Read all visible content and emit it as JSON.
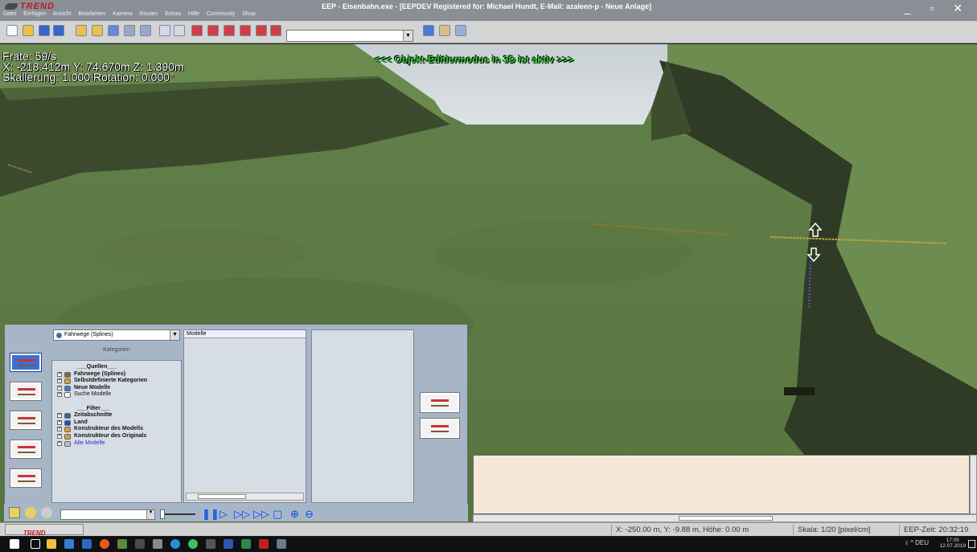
{
  "window": {
    "logo": "TREND",
    "title": "EEP - Eisenbahn.exe - [EEPDEV Registered for: Michael Hundt, E-Mail: azaleen-p - Neue Anlage]",
    "controls": "_ ▫ ✕"
  },
  "menu": [
    "Datei",
    "Einfügen",
    "Ansicht",
    "Bearbeiten",
    "Kamera",
    "Routen",
    "Extras",
    "Hilfe",
    "Community",
    "Shop"
  ],
  "hud": {
    "frate": "Frate: 59/s",
    "coords": "X: -218.412m Y: 74.670m Z: 1.390m",
    "scale": "Skalierung: 1.000 Rotation: 0.000°",
    "mode_banner": "<<<  Objekt-Editiermodus in 3D ist aktiv  >>>"
  },
  "panel": {
    "category_combo": "Fahrwege (Splines)",
    "categories_header": "Kategorien",
    "models_header": "Modelle",
    "tree": [
      {
        "type": "sec",
        "label": "___Quellen___"
      },
      {
        "type": "item",
        "label": "Fahrwege (Splines)",
        "bold": true,
        "icon_color": "#7a6b3a"
      },
      {
        "type": "item",
        "label": "Selbstdefinierte Kategorien",
        "bold": true,
        "icon_color": "#d8a030"
      },
      {
        "type": "item",
        "label": "Neue Modelle",
        "bold": true,
        "icon_color": "#3a7ad0"
      },
      {
        "type": "item",
        "label": "Suche Modelle",
        "bold": false,
        "icon_color": "#ffffff"
      },
      {
        "type": "blank",
        "label": ""
      },
      {
        "type": "sec",
        "label": "___Filter___"
      },
      {
        "type": "item",
        "label": "Zeitabschnitte",
        "bold": true,
        "icon_color": "#2a6aa0"
      },
      {
        "type": "item",
        "label": "Land",
        "bold": true,
        "icon_color": "#2a4ad0"
      },
      {
        "type": "item",
        "label": "Konstrukteur des Modells",
        "bold": true,
        "icon_color": "#d8a030"
      },
      {
        "type": "item",
        "label": "Konstrukteur des Originals",
        "bold": true,
        "icon_color": "#d8a030"
      },
      {
        "type": "item",
        "label": "Alte Modelle",
        "bold": false,
        "blue": true,
        "icon_color": "#c0c0c0"
      }
    ]
  },
  "status": {
    "coords": "X: -250.00 m, Y: -9.88 m, Höhe: 0.00 m",
    "scale": "Skala: 1/20 [pixel/cm]",
    "time": "EEP-Zeit: 20:32:19"
  },
  "taskbar": {
    "language": "DEU",
    "time": "17:05",
    "date": "12.07.2019"
  },
  "colors": {
    "grass": "#5f7d45",
    "cliff": "#3b4a2c",
    "sky": "#cdd3d6",
    "panel": "#a7b6c6",
    "message_bg": "#f7e7d8",
    "mode_text": "#3cd23c"
  }
}
